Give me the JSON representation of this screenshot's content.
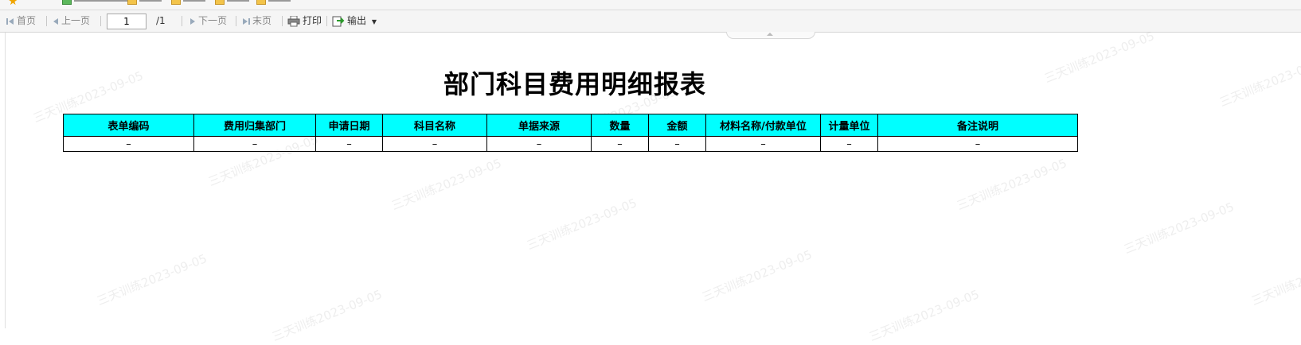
{
  "toolbar": {
    "first_page": "首页",
    "prev_page": "上一页",
    "page_input": "1",
    "page_total": "/1",
    "next_page": "下一页",
    "last_page": "末页",
    "print": "打印",
    "export": "输出"
  },
  "report": {
    "title": "部门科目费用明细报表",
    "columns": [
      "表单编码",
      "费用归集部门",
      "申请日期",
      "科目名称",
      "单据来源",
      "数量",
      "金额",
      "材料名称/付款单位",
      "计量单位",
      "备注说明"
    ],
    "rows": [
      [
        "–",
        "–",
        "–",
        "–",
        "–",
        "–",
        "–",
        "–",
        "–",
        "–"
      ]
    ],
    "header_color": "#00ffff"
  },
  "watermark": {
    "text": "三天训练2023-09-05"
  }
}
